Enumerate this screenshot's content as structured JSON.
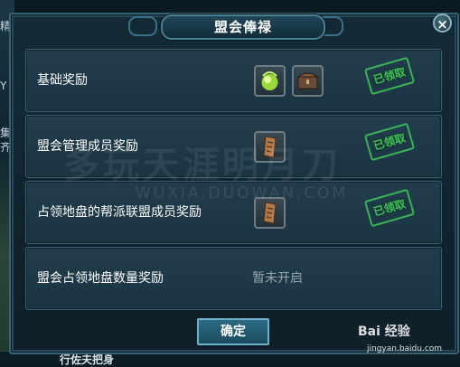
{
  "dialog": {
    "title": "盟会俸禄",
    "close_label": "×",
    "confirm_label": "确定"
  },
  "rows": [
    {
      "label": "基础奖励",
      "stamp": "已领取",
      "items": [
        "green-orb-icon",
        "treasure-chest-icon"
      ]
    },
    {
      "label": "盟会管理成员奖励",
      "stamp": "已领取",
      "items": [
        "token-icon"
      ]
    },
    {
      "label": "占领地盘的帮派联盟成员奖励",
      "stamp": "已领取",
      "items": [
        "token-icon"
      ]
    },
    {
      "label": "盟会占领地盘数量奖励",
      "status": "暂未开启"
    }
  ],
  "background": {
    "left_chars": [
      "精",
      "Y",
      "集",
      "齐"
    ],
    "bottom_text": "行佐夫把身"
  },
  "watermark": {
    "main": "多玩天涯明月刀",
    "sub": "WUXIA.DUOWAN.COM",
    "brand": "Bai 经验",
    "brand_url": "jingyan.baidu.com"
  }
}
